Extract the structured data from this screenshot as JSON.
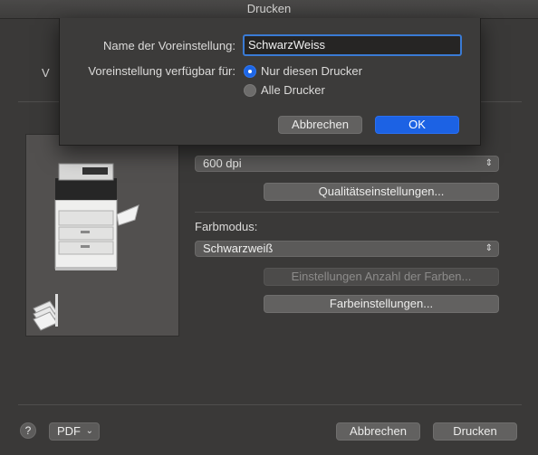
{
  "window": {
    "title": "Drucken"
  },
  "behind_dialog": {
    "left_label_fragment": "V"
  },
  "quality": {
    "resolution_value": "600 dpi",
    "quality_settings_button": "Qualitätseinstellungen..."
  },
  "color": {
    "section_label": "Farbmodus:",
    "mode_value": "Schwarzweiß",
    "color_count_button": "Einstellungen Anzahl der Farben...",
    "color_settings_button": "Farbeinstellungen..."
  },
  "footer": {
    "help_label": "?",
    "pdf_label": "PDF",
    "cancel_label": "Abbrechen",
    "print_label": "Drucken"
  },
  "preset_dialog": {
    "name_label": "Name der Voreinstellung:",
    "name_value": "SchwarzWeiss",
    "availability_label": "Voreinstellung verfügbar für:",
    "options": [
      {
        "label": "Nur diesen Drucker",
        "selected": true
      },
      {
        "label": "Alle Drucker",
        "selected": false
      }
    ],
    "cancel_label": "Abbrechen",
    "ok_label": "OK"
  },
  "colors": {
    "accent": "#1c62e4",
    "focus_ring": "#3a7bd5"
  }
}
